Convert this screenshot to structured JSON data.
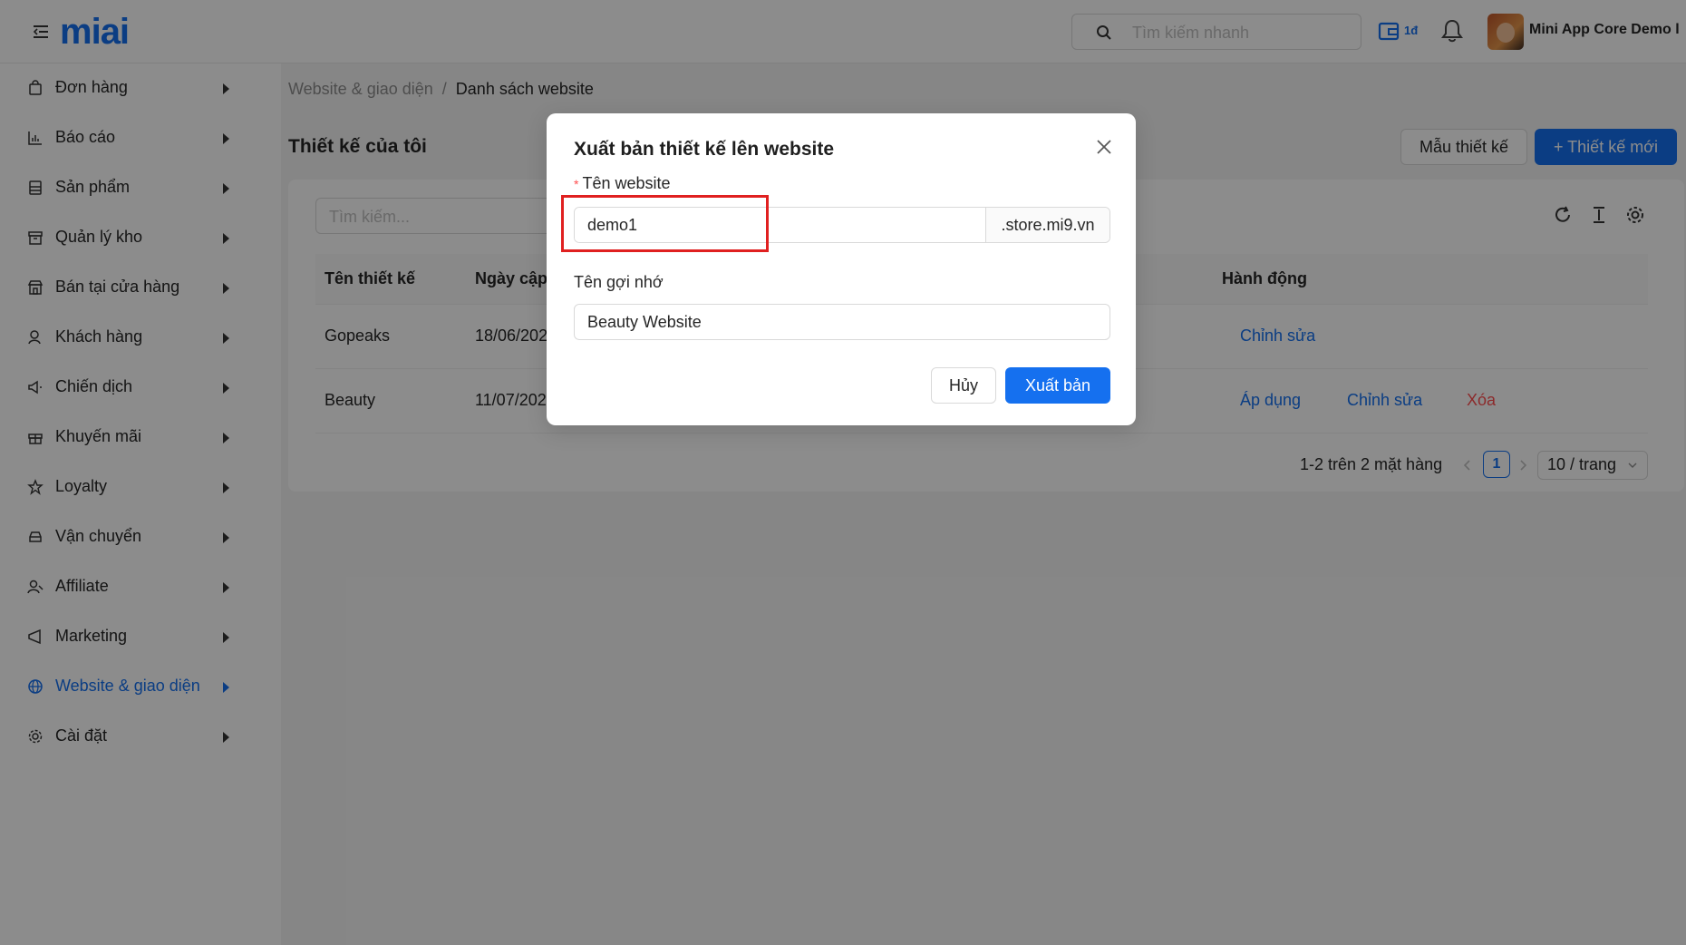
{
  "header": {
    "logo_text": "mi",
    "logo_accent": "ai",
    "search_placeholder": "Tìm kiếm nhanh",
    "wallet_label": "1đ",
    "user_name": "Mini App Core Demo l"
  },
  "sidebar": {
    "items": [
      {
        "label": "Đơn hàng",
        "icon": "shopping-bag-icon"
      },
      {
        "label": "Báo cáo",
        "icon": "bar-chart-icon"
      },
      {
        "label": "Sản phẩm",
        "icon": "product-icon"
      },
      {
        "label": "Quản lý kho",
        "icon": "warehouse-icon"
      },
      {
        "label": "Bán tại cửa hàng",
        "icon": "store-icon"
      },
      {
        "label": "Khách hàng",
        "icon": "user-icon"
      },
      {
        "label": "Chiến dịch",
        "icon": "megaphone-icon"
      },
      {
        "label": "Khuyến mãi",
        "icon": "gift-icon"
      },
      {
        "label": "Loyalty",
        "icon": "star-icon"
      },
      {
        "label": "Vận chuyển",
        "icon": "car-icon"
      },
      {
        "label": "Affiliate",
        "icon": "affiliate-icon"
      },
      {
        "label": "Marketing",
        "icon": "marketing-icon"
      },
      {
        "label": "Website & giao diện",
        "icon": "globe-icon",
        "active": true
      },
      {
        "label": "Cài đặt",
        "icon": "gear-icon"
      }
    ]
  },
  "breadcrumb": {
    "parent": "Website & giao diện",
    "separator": "/",
    "current": "Danh sách website"
  },
  "page": {
    "title": "Thiết kế của tôi",
    "template_button": "Mẫu thiết kế",
    "new_button": "+ Thiết kế mới",
    "search_placeholder": "Tìm kiếm..."
  },
  "table": {
    "columns": [
      "Tên thiết kế",
      "Ngày cập",
      "Hành động"
    ],
    "rows": [
      {
        "name": "Gopeaks",
        "date": "18/06/202",
        "actions": [
          "Chỉnh sửa"
        ]
      },
      {
        "name": "Beauty",
        "date": "11/07/202",
        "actions": [
          "Áp dụng",
          "Chỉnh sửa",
          "Xóa"
        ]
      }
    ]
  },
  "pagination": {
    "info": "1-2 trên 2 mặt hàng",
    "current_page": "1",
    "page_size": "10 / trang"
  },
  "modal": {
    "title": "Xuất bản thiết kế lên website",
    "website_label": "Tên website",
    "required_mark": "*",
    "website_value": "demo1",
    "website_suffix": ".store.mi9.vn",
    "memo_label": "Tên gợi nhớ",
    "memo_value": "Beauty Website",
    "cancel_button": "Hủy",
    "publish_button": "Xuất bản"
  },
  "colors": {
    "primary": "#1570ef",
    "danger": "#ff4d4f",
    "highlight": "#e02020"
  }
}
